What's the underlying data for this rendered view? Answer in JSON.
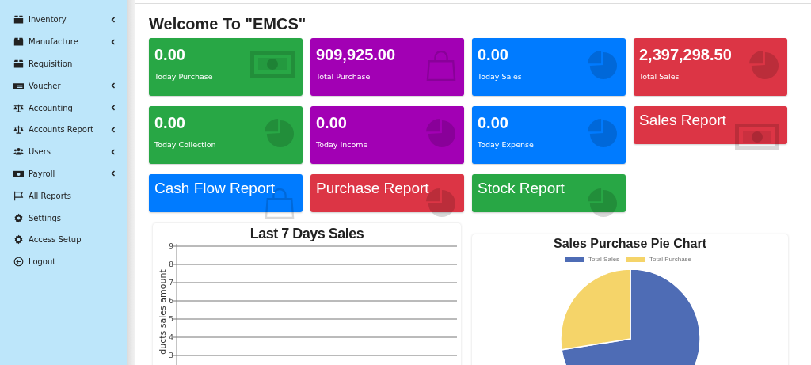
{
  "sidebar": {
    "items": [
      {
        "label": "Inventory",
        "has_submenu": true
      },
      {
        "label": "Manufacture",
        "has_submenu": true
      },
      {
        "label": "Requisition",
        "has_submenu": false
      },
      {
        "label": "Voucher",
        "has_submenu": true
      },
      {
        "label": "Accounting",
        "has_submenu": true
      },
      {
        "label": "Accounts Report",
        "has_submenu": true
      },
      {
        "label": "Users",
        "has_submenu": true
      },
      {
        "label": "Payroll",
        "has_submenu": true
      },
      {
        "label": "All Reports",
        "has_submenu": false
      },
      {
        "label": "Settings",
        "has_submenu": false
      },
      {
        "label": "Access Setup",
        "has_submenu": false
      },
      {
        "label": "Logout",
        "has_submenu": false
      }
    ]
  },
  "heading": "Welcome To \"EMCS\"",
  "cards": [
    {
      "kind": "stat",
      "value": "0.00",
      "label": "Today Purchase",
      "color": "#28a745"
    },
    {
      "kind": "stat",
      "value": "909,925.00",
      "label": "Total Purchase",
      "color": "#a200b4"
    },
    {
      "kind": "stat",
      "value": "0.00",
      "label": "Today Sales",
      "color": "#007bff"
    },
    {
      "kind": "stat",
      "value": "2,397,298.50",
      "label": "Total Sales",
      "color": "#dc3545"
    },
    {
      "kind": "stat",
      "value": "0.00",
      "label": "Today Collection",
      "color": "#28a745"
    },
    {
      "kind": "stat",
      "value": "0.00",
      "label": "Today Income",
      "color": "#a200b4"
    },
    {
      "kind": "stat",
      "value": "0.00",
      "label": "Today Expense",
      "color": "#007bff"
    },
    {
      "kind": "report",
      "label": "Sales Report",
      "color": "#dc3545"
    },
    {
      "kind": "report",
      "label": "Cash Flow Report",
      "color": "#007bff"
    },
    {
      "kind": "report",
      "label": "Purchase Report",
      "color": "#dc3545"
    },
    {
      "kind": "report",
      "label": "Stock Report",
      "color": "#28a745"
    }
  ],
  "sales_chart": {
    "title": "Last 7 Days Sales",
    "axis_title": "ducts sales amount",
    "axis_labels": [
      "9",
      "8",
      "7",
      "6",
      "5",
      "4",
      "3"
    ]
  },
  "pie_chart": {
    "chart_data": {
      "type": "pie",
      "title": "Sales Purchase Pie Chart",
      "categories": [
        "Total Sales",
        "Total Purchase"
      ],
      "values": [
        72.49,
        27.51
      ],
      "colors": [
        "#4e6cb5",
        "#f5d469"
      ]
    }
  }
}
